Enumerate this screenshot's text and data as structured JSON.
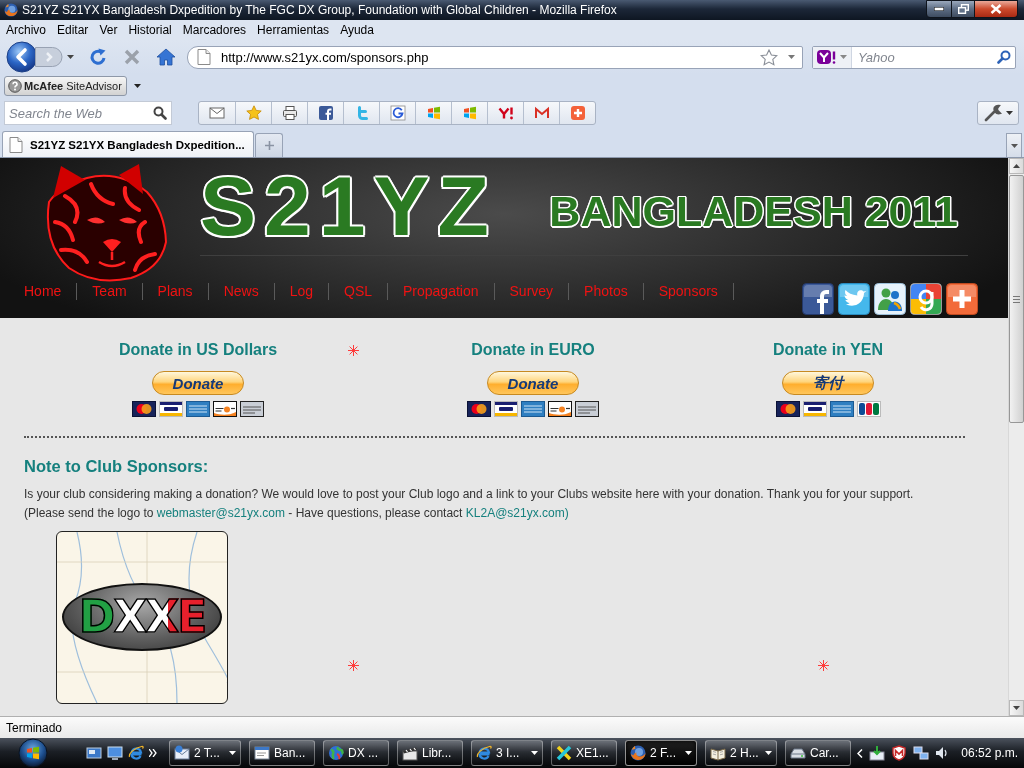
{
  "window": {
    "title": "S21YZ S21YX Bangladesh Dxpedition by The FGC DX Group, Foundation with Global Children - Mozilla Firefox"
  },
  "menu": [
    {
      "label": "Archivo"
    },
    {
      "label": "Editar"
    },
    {
      "label": "Ver"
    },
    {
      "label": "Historial"
    },
    {
      "label": "Marcadores"
    },
    {
      "label": "Herramientas"
    },
    {
      "label": "Ayuda"
    }
  ],
  "navigation": {
    "url": "http://www.s21yx.com/sponsors.php",
    "search_placeholder": "Yahoo"
  },
  "siteadvisor": {
    "label": "**McAfee** SiteAdvisor"
  },
  "search_toolbar": {
    "placeholder": "Search the Web",
    "buttons": [
      {
        "kind": "mail"
      },
      {
        "kind": "star"
      },
      {
        "kind": "print"
      },
      {
        "kind": "facebook"
      },
      {
        "kind": "twitter"
      },
      {
        "kind": "google"
      },
      {
        "kind": "windows"
      },
      {
        "kind": "windows"
      },
      {
        "kind": "yahoo"
      },
      {
        "kind": "gmail"
      },
      {
        "kind": "plus"
      }
    ]
  },
  "tabs": [
    {
      "label": "S21YZ S21YX Bangladesh Dxpedition...",
      "selected": true
    }
  ],
  "page": {
    "header": {
      "logo": "S21YZ",
      "subtitle": "BANGLADESH 2011",
      "nav": [
        {
          "label": "Home"
        },
        {
          "label": "Team"
        },
        {
          "label": "Plans"
        },
        {
          "label": "News"
        },
        {
          "label": "Log"
        },
        {
          "label": "QSL"
        },
        {
          "label": "Propagation"
        },
        {
          "label": "Survey"
        },
        {
          "label": "Photos"
        },
        {
          "label": "Sponsors"
        }
      ],
      "social": [
        {
          "kind": "facebook"
        },
        {
          "kind": "twitter"
        },
        {
          "kind": "messenger"
        },
        {
          "kind": "google"
        },
        {
          "kind": "plus"
        }
      ]
    },
    "donations": [
      {
        "title": "Donate in US Dollars",
        "button": "Donate",
        "cards": [
          {
            "kind": "mastercard"
          },
          {
            "kind": "visa"
          },
          {
            "kind": "amex"
          },
          {
            "kind": "discover"
          },
          {
            "kind": "bank"
          }
        ]
      },
      {
        "title": "Donate in EURO",
        "button": "Donate",
        "cards": [
          {
            "kind": "mastercard"
          },
          {
            "kind": "visa"
          },
          {
            "kind": "amex"
          },
          {
            "kind": "discover"
          },
          {
            "kind": "bank"
          }
        ]
      },
      {
        "title": "Donate in YEN",
        "button": "寄付",
        "cards": [
          {
            "kind": "mastercard"
          },
          {
            "kind": "visa"
          },
          {
            "kind": "amex"
          },
          {
            "kind": "jcb"
          }
        ]
      }
    ],
    "note": {
      "heading": "Note to Club Sponsors:",
      "lines": [
        {
          "segments": [
            {
              "kind": "text",
              "text": "Is your club considering making a donation? We would love to post your Club logo and a link to your Clubs website here with your donation. Thank you for your support."
            }
          ]
        },
        {
          "segments": [
            {
              "kind": "text",
              "text": "(Please send the logo to "
            },
            {
              "kind": "link",
              "text": "webmaster@s21yx.com"
            },
            {
              "kind": "text",
              "text": " - Have questions, please contact "
            },
            {
              "kind": "link",
              "text": "KL2A@s21yx.com)"
            }
          ]
        }
      ]
    },
    "sponsors": [
      {
        "logo_text": "DXXE"
      }
    ]
  },
  "status_bar": {
    "text": "Terminado"
  },
  "taskbar": {
    "tasks": [
      {
        "label": "2 T...",
        "kind": "mail",
        "grouped": true,
        "selected": false
      },
      {
        "label": "Ban...",
        "kind": "window",
        "grouped": false,
        "selected": false
      },
      {
        "label": "DX ...",
        "kind": "globe",
        "grouped": false,
        "selected": false
      },
      {
        "label": "Libr...",
        "kind": "clapper",
        "grouped": false,
        "selected": false
      },
      {
        "label": "3 I...",
        "kind": "browser",
        "grouped": true,
        "selected": false
      },
      {
        "label": "XE1...",
        "kind": "cross",
        "grouped": false,
        "selected": false
      },
      {
        "label": "2 F...",
        "kind": "fox",
        "grouped": true,
        "selected": true
      },
      {
        "label": "2 H...",
        "kind": "book",
        "grouped": true,
        "selected": false
      },
      {
        "label": "Car...",
        "kind": "drive",
        "grouped": false,
        "selected": false
      }
    ],
    "clock": "06:52 p.m."
  }
}
